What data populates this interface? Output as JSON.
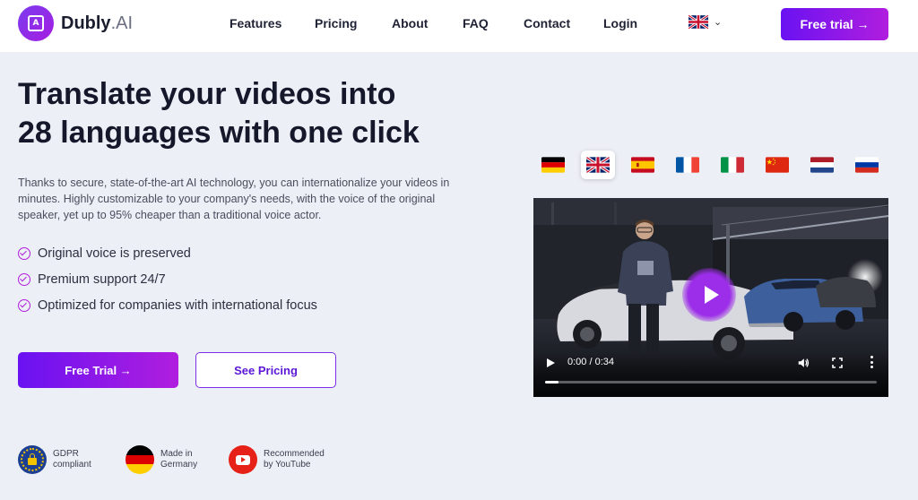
{
  "nav": {
    "brand_bold": "Dubly",
    "brand_light": ".AI",
    "links": [
      "Features",
      "Pricing",
      "About",
      "FAQ",
      "Contact",
      "Login"
    ],
    "language_flag": "uk-flag-icon",
    "cta": "Free trial →"
  },
  "hero": {
    "headline_line1": "Translate your videos into",
    "headline_line2": "28 languages with one click",
    "intro": "Thanks to secure, state-of-the-art AI technology, you can internationalize your videos in minutes. Highly customizable to your company's needs, with the voice of the original speaker, yet up to 95% cheaper than a traditional voice actor.",
    "features": [
      "Original voice is preserved",
      "Premium support 24/7",
      "Optimized for companies with international focus"
    ],
    "primary_cta": "Free Trial →",
    "secondary_cta": "See Pricing"
  },
  "badges": [
    {
      "icon": "eu-gdpr-lock-icon",
      "line1": "GDPR",
      "line2": "compliant"
    },
    {
      "icon": "germany-flag-icon",
      "line1": "Made in",
      "line2": "Germany"
    },
    {
      "icon": "youtube-icon",
      "line1": "Recommended",
      "line2": "by YouTube"
    }
  ],
  "language_flags": {
    "items": [
      "germany",
      "united-kingdom",
      "spain",
      "france",
      "italy",
      "china",
      "netherlands",
      "russia"
    ],
    "selected": "united-kingdom"
  },
  "video": {
    "time": "0:00 / 0:34",
    "progress_fraction": 0.04,
    "accent": "#9c2de8"
  },
  "colors": {
    "brand_gradient_start": "#6a12f2",
    "brand_gradient_end": "#b01ede",
    "page_bg": "#eceff5"
  }
}
